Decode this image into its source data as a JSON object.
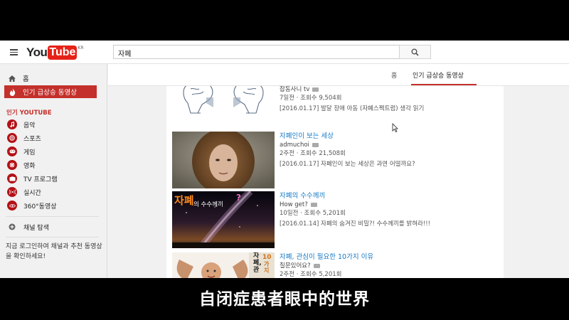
{
  "masthead": {
    "logo_you": "You",
    "logo_tube": "Tube",
    "logo_region": "KR",
    "search_value": "자폐"
  },
  "sidebar": {
    "home_label": "홈",
    "trending_label": "인기 급상승 동영상",
    "section_title": "인기 YOUTUBE",
    "channels": [
      {
        "label": "음악",
        "icon": "music-icon"
      },
      {
        "label": "스포츠",
        "icon": "sports-icon"
      },
      {
        "label": "게임",
        "icon": "gaming-icon"
      },
      {
        "label": "영화",
        "icon": "movie-icon"
      },
      {
        "label": "TV 프로그램",
        "icon": "tv-icon"
      },
      {
        "label": "실시간",
        "icon": "live-icon"
      },
      {
        "label": "360°동영상",
        "icon": "360-icon"
      }
    ],
    "browse_channels": "채널 탐색",
    "login_text": "지금 로그인하여 채널과 추천 동영상을 확인하세요!"
  },
  "tabs": {
    "home": "홈",
    "trending": "인기 급상승 동영상"
  },
  "videos": [
    {
      "channel": "잡동사니 tv",
      "stats": "7일전 · 조회수 9,504회",
      "desc": "[2016.01.17] 발달 장애 아동 (자폐스펙트럼) 생각 읽기"
    },
    {
      "title": "자폐인이 보는 세상",
      "channel": "admuchoi",
      "stats": "2주전 · 조회수 21,508회",
      "desc": "[2016.01.17] 자폐인이 보는 세상은 과연 어떨까요?"
    },
    {
      "title": "자폐의 수수께끼",
      "thumb_big": "자폐",
      "thumb_small": "의 수수께끼",
      "thumb_q": "?",
      "channel": "How get?",
      "stats": "10일전 · 조회수 5,201회",
      "desc": "[2016.01.14] 자폐의 숨겨진 비밀?! 수수께끼를 밝혀라!!!"
    },
    {
      "title": "자폐, 관심이 필요한 10가지 이유",
      "thumb_num": "10",
      "thumb_text": "가지",
      "thumb_side": "자폐,관",
      "channel": "질문있어요?",
      "stats": "2주전 · 조회수 5,201회"
    }
  ],
  "subtitle": "自闭症患者眼中的世界",
  "colors": {
    "accent": "#c4302b",
    "link": "#167ac6",
    "youtube_red": "#e62117"
  }
}
